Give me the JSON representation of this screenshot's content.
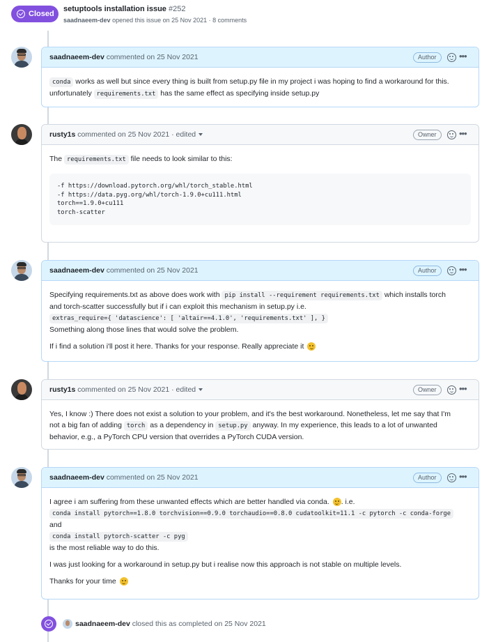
{
  "issue": {
    "status": "Closed",
    "title": "setuptools installation issue",
    "number": "#252",
    "author": "saadnaeem-dev",
    "meta_text": "opened this issue on 25 Nov 2021 · 8 comments"
  },
  "comments": [
    {
      "user": "saadnaeem-dev",
      "action": "commented on 25 Nov 2021",
      "edited": "",
      "role": "Author",
      "body": {
        "code1": "conda",
        "t1": " works as well but since every thing is built from setup.py file in my project i was hoping to find a workaround for this.",
        "t2": "unfortunately ",
        "code2": "requirements.txt",
        "t3": " has the same effect as specifying inside setup.py"
      }
    },
    {
      "user": "rusty1s",
      "action": "commented on 25 Nov 2021 · ",
      "edited": "edited",
      "role": "Owner",
      "body": {
        "t1": "The ",
        "code1": "requirements.txt",
        "t2": " file needs to look similar to this:",
        "codeblock": "-f https://download.pytorch.org/whl/torch_stable.html\n-f https://data.pyg.org/whl/torch-1.9.0+cu111.html\ntorch==1.9.0+cu111\ntorch-scatter"
      }
    },
    {
      "user": "saadnaeem-dev",
      "action": "commented on 25 Nov 2021",
      "edited": "",
      "role": "Author",
      "body": {
        "t1": "Specifying requirements.txt as above does work with ",
        "code1": "pip install --requirement requirements.txt",
        "t2": " which installs torch",
        "t3": "and torch-scatter successfully but if i can exploit this mechanism in setup.py i.e.",
        "code2": "extras_require={ 'datascience': [ 'altair==4.1.0', 'requirements.txt' ], }",
        "t4": "Something along those lines that would solve the problem.",
        "t5": "If i find a solution i'll post it here. Thanks for your response. Really appreciate it"
      }
    },
    {
      "user": "rusty1s",
      "action": "commented on 25 Nov 2021 · ",
      "edited": "edited",
      "role": "Owner",
      "body": {
        "t1": "Yes, I know :) There does not exist a solution to your problem, and it's the best workaround. Nonetheless, let me say that I'm",
        "t2": "not a big fan of adding ",
        "code1": "torch",
        "t3": " as a dependency in ",
        "code2": "setup.py",
        "t4": " anyway. In my experience, this leads to a lot of unwanted",
        "t5": "behavior, e.g., a PyTorch CPU version that overrides a PyTorch CUDA version."
      }
    },
    {
      "user": "saadnaeem-dev",
      "action": "commented on 25 Nov 2021",
      "edited": "",
      "role": "Author",
      "body": {
        "t1": "I agree i am suffering from these unwanted effects which are better handled via conda.",
        "t1b": ". i.e.",
        "code1": "conda install pytorch==1.8.0 torchvision==0.9.0 torchaudio==0.8.0 cudatoolkit=11.1 -c pytorch -c conda-forge",
        "t2": "and",
        "code2": "conda install pytorch-scatter -c pyg",
        "t3": "is the most reliable way to do this.",
        "t4": "I was just looking for a workaround in setup.py but i realise now this approach is not stable on multiple levels.",
        "t5": "Thanks for your time"
      }
    }
  ],
  "closed_event": {
    "user": "saadnaeem-dev",
    "text": "closed this as completed on 25 Nov 2021"
  }
}
